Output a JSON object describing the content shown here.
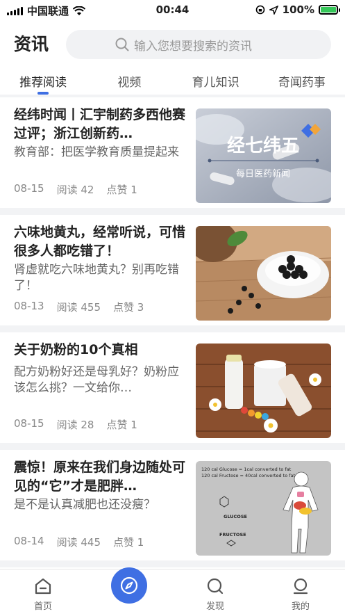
{
  "status_bar": {
    "carrier": "中国联通",
    "time": "00:44",
    "battery": "100%",
    "battery_level": 1.0
  },
  "header": {
    "title": "资讯",
    "search_placeholder": "输入您想要搜索的资讯"
  },
  "tabs": [
    {
      "label": "推荐阅读",
      "active": true
    },
    {
      "label": "视频",
      "active": false
    },
    {
      "label": "育儿知识",
      "active": false
    },
    {
      "label": "奇闻药事",
      "active": false
    }
  ],
  "articles": [
    {
      "headline": "经纬时闻丨汇宇制药多西他赛过评；浙江创新药…",
      "summary": "教育部：把医学教育质量提起来",
      "date": "08-15",
      "reads": "阅读 42",
      "likes": "点赞 1",
      "image_title": "经七纬五",
      "image_subtitle": "每日医药新闻"
    },
    {
      "headline": "六味地黄丸，经常听说，可惜很多人都吃错了！",
      "summary": "肾虚就吃六味地黄丸？别再吃错了！",
      "date": "08-13",
      "reads": "阅读 455",
      "likes": "点赞 3"
    },
    {
      "headline": "关于奶粉的10个真相",
      "summary": "配方奶粉好还是母乳好？奶粉应该怎么挑？一文给你…",
      "date": "08-15",
      "reads": "阅读 28",
      "likes": "点赞 1"
    },
    {
      "headline": "震惊！原来在我们身边随处可见的“它”才是肥胖…",
      "summary": "是不是认真减肥也还没瘦？",
      "date": "08-14",
      "reads": "阅读 445",
      "likes": "点赞 1",
      "image_lines": [
        "120 cal Glucose = 1cal converted to fat",
        "120 cal Fructose = 40cal converted to fat",
        "GLUCOSE",
        "FRUCTOSE"
      ]
    }
  ],
  "bottom_nav": {
    "home": "首页",
    "discover": "发现",
    "mine": "我的"
  },
  "colors": {
    "accent": "#3f6fe3",
    "background": "#f2f3f5"
  }
}
